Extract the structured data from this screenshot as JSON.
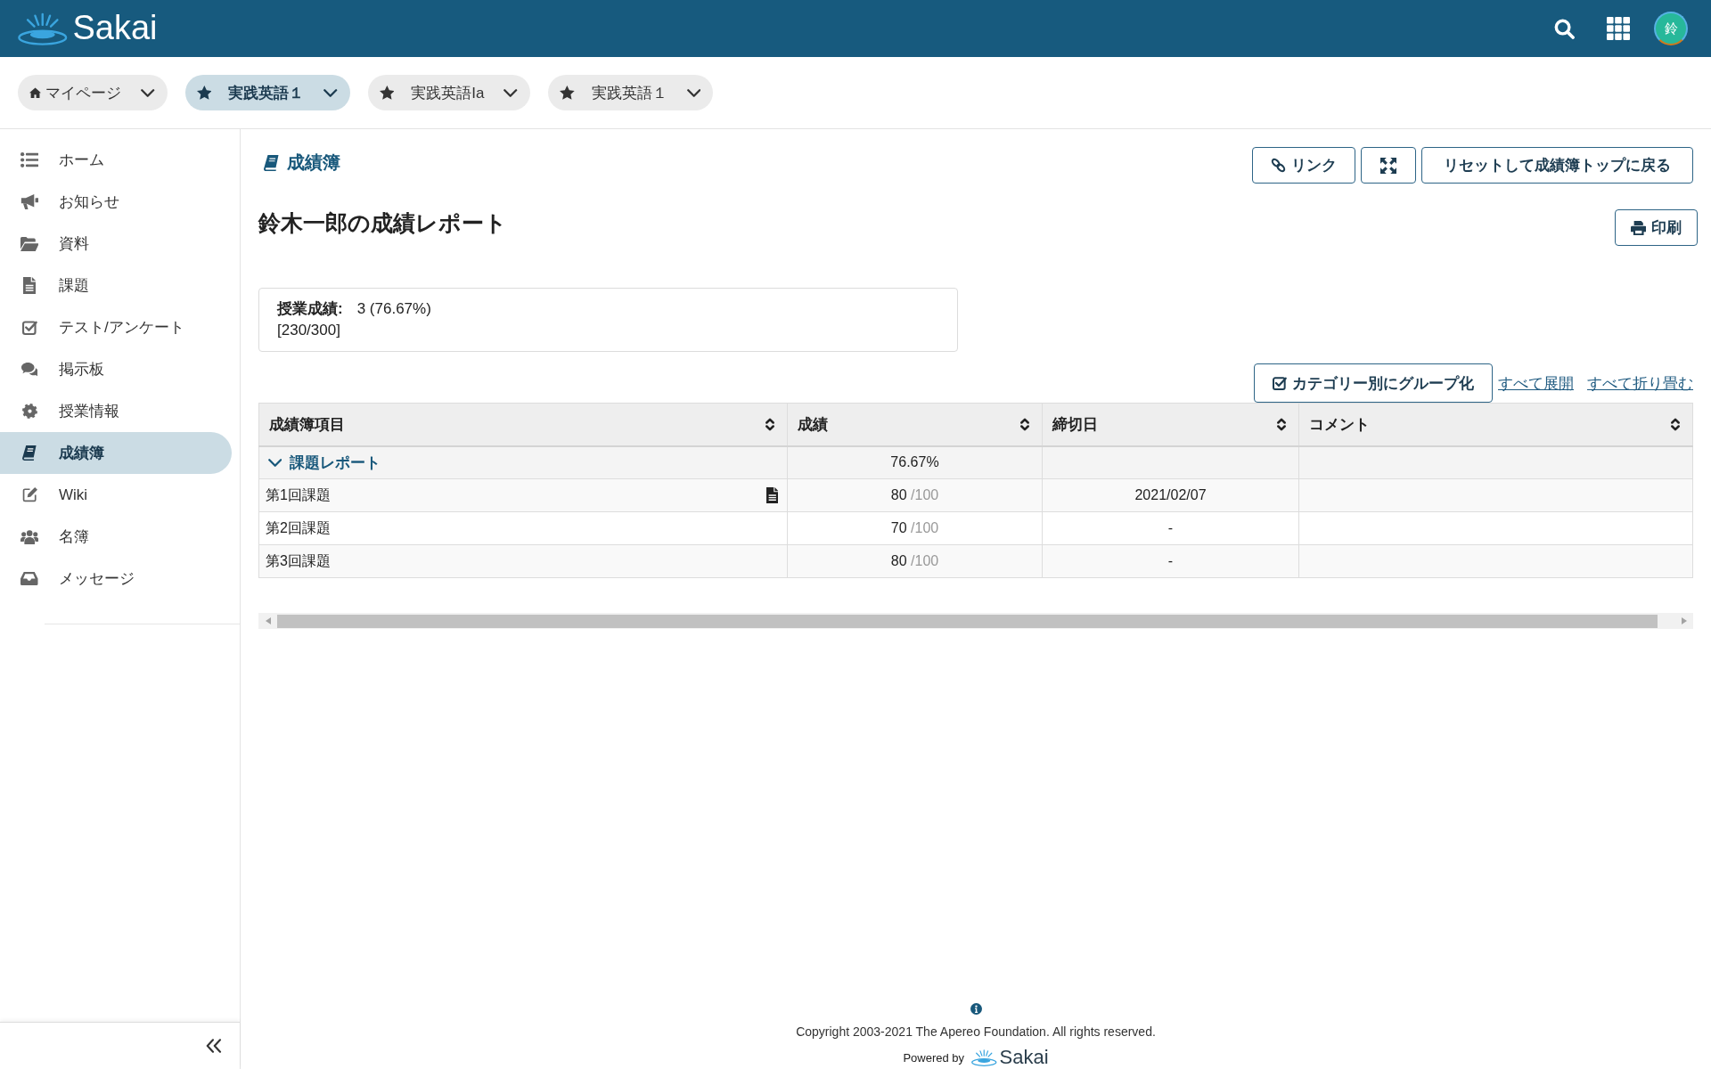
{
  "header": {
    "logo_text": "Sakai",
    "avatar_initial": "鈴"
  },
  "site_tabs": [
    {
      "kind": "home",
      "label": "マイページ",
      "selected": false
    },
    {
      "kind": "favorite",
      "label": "実践英語１",
      "selected": true
    },
    {
      "kind": "favorite",
      "label": "実践英語Ia",
      "selected": false
    },
    {
      "kind": "favorite",
      "label": "実践英語１",
      "selected": false
    }
  ],
  "sidebar": {
    "items": [
      {
        "kind": "home",
        "label": "ホーム",
        "selected": false
      },
      {
        "kind": "announcements",
        "label": "お知らせ",
        "selected": false
      },
      {
        "kind": "resources",
        "label": "資料",
        "selected": false
      },
      {
        "kind": "assignments",
        "label": "課題",
        "selected": false
      },
      {
        "kind": "tests",
        "label": "テスト/アンケート",
        "selected": false
      },
      {
        "kind": "forums",
        "label": "掲示板",
        "selected": false
      },
      {
        "kind": "syllabus",
        "label": "授業情報",
        "selected": false
      },
      {
        "kind": "gradebook",
        "label": "成績簿",
        "selected": true
      },
      {
        "kind": "wiki",
        "label": "Wiki",
        "selected": false
      },
      {
        "kind": "roster",
        "label": "名簿",
        "selected": false
      },
      {
        "kind": "messages",
        "label": "メッセージ",
        "selected": false
      }
    ]
  },
  "tool": {
    "title": "成績簿",
    "buttons": [
      {
        "kind": "link",
        "label": "リンク"
      },
      {
        "kind": "fullscreen"
      },
      {
        "kind": "reset",
        "label": "リセットして成績簿トップに戻る"
      }
    ]
  },
  "report": {
    "heading": "鈴木一郎の成績レポート",
    "print_button": "印刷",
    "course_grade": {
      "label": "授業成績:",
      "value": "3 (76.67%)",
      "points": "[230/300]"
    }
  },
  "table_controls": {
    "group_by_category": {
      "label": "カテゴリー別にグループ化",
      "checked": true
    },
    "links": [
      "すべて展開",
      "すべて折り畳む"
    ]
  },
  "table": {
    "columns": [
      "成績簿項目",
      "成績",
      "締切日",
      "コメント"
    ],
    "rows": [
      {
        "kind": "category",
        "name": "課題レポート",
        "expanded": true,
        "grade": "76.67%"
      },
      {
        "kind": "item",
        "name": "第1回課題",
        "attachment": true,
        "score": "80",
        "out_of": "/100",
        "due": "2021/02/07"
      },
      {
        "kind": "item",
        "name": "第2回課題",
        "attachment": false,
        "score": "70",
        "out_of": "/100",
        "due": "-"
      },
      {
        "kind": "item",
        "name": "第3回課題",
        "attachment": false,
        "score": "80",
        "out_of": "/100",
        "due": "-"
      }
    ]
  },
  "footer": {
    "copyright": "Copyright 2003-2021 The Apereo Foundation. All rights reserved.",
    "powered_by": "Powered by",
    "logo_text": "Sakai"
  }
}
